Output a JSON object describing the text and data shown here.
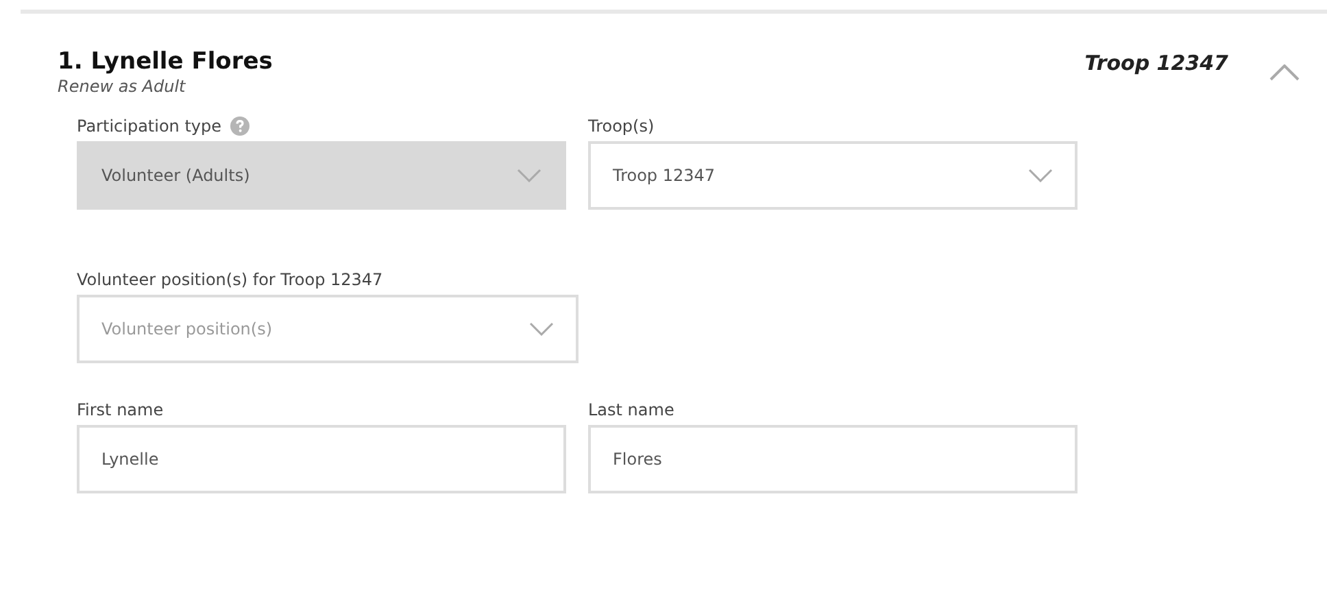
{
  "header": {
    "title": "1. Lynelle Flores",
    "subtitle": "Renew as Adult",
    "troop": "Troop 12347",
    "expanded": true
  },
  "rows": [
    [
      {
        "kind": "select",
        "label": "Participation type",
        "help": true,
        "value": "Volunteer (Adults)",
        "disabled": true
      },
      {
        "kind": "select",
        "label": "Troop(s)",
        "value": "Troop 12347",
        "disabled": false
      }
    ],
    [
      {
        "kind": "select",
        "label": "Volunteer position(s) for Troop 12347",
        "placeholder": "Volunteer position(s)",
        "disabled": false
      }
    ],
    [
      {
        "kind": "input",
        "label": "First name",
        "value": "Lynelle",
        "disabled": false
      },
      {
        "kind": "input",
        "label": "Last name",
        "value": "Flores",
        "disabled": false
      }
    ]
  ]
}
